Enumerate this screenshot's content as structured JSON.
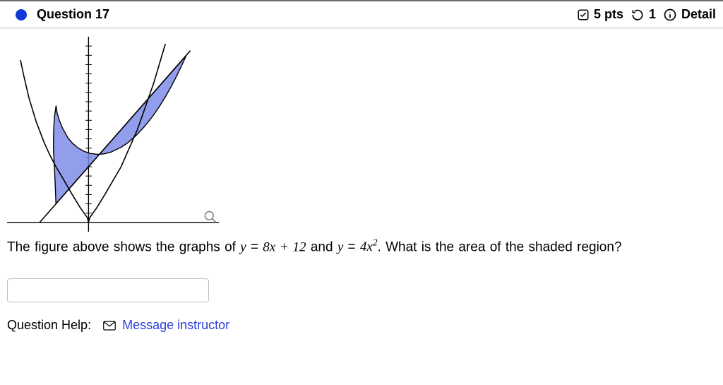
{
  "header": {
    "title": "Question 17",
    "points_text": "5 pts",
    "attempts_text": "1",
    "details_label": "Detail"
  },
  "graph": {
    "eq_line": "y = 8x + 12",
    "eq_parabola": "y = 4x^2",
    "x_range": [
      -2.5,
      4
    ],
    "y_range": [
      -2,
      40
    ],
    "intersections_x": [
      -1,
      3
    ],
    "shaded_fill": "#7a88e8",
    "shaded_stroke": "#000"
  },
  "prompt": {
    "lead": "The figure above shows the graphs of ",
    "mid1": " and ",
    "mid2": ". What is the area of the shaded region?",
    "eq1_lhs": "y",
    "eq1_rhs": "8x + 12",
    "eq2_lhs": "y",
    "eq2_rhs_base": "4x",
    "eq2_rhs_exp": "2",
    "eq_sign": " = "
  },
  "answer": {
    "value": "",
    "placeholder": ""
  },
  "help": {
    "label": "Question Help:",
    "link_text": "Message instructor"
  },
  "icons": {
    "bullet": "status-bullet-icon",
    "check": "check-square-icon",
    "retry": "retry-icon",
    "info": "info-circle-icon",
    "zoom": "zoom-icon",
    "mail": "mail-icon"
  },
  "chart_data": {
    "type": "line",
    "title": "",
    "xlabel": "",
    "ylabel": "",
    "x": [
      -2.5,
      -2,
      -1.5,
      -1,
      -0.5,
      0,
      0.5,
      1,
      1.5,
      2,
      2.5,
      3,
      3.5,
      4
    ],
    "series": [
      {
        "name": "y = 8x + 12",
        "values": [
          -8,
          -4,
          0,
          4,
          8,
          12,
          16,
          20,
          24,
          28,
          32,
          36,
          40,
          44
        ]
      },
      {
        "name": "y = 4x^2",
        "values": [
          25,
          16,
          9,
          4,
          1,
          0,
          1,
          4,
          9,
          16,
          25,
          36,
          49,
          64
        ]
      }
    ],
    "xlim": [
      -2.5,
      4
    ],
    "ylim": [
      -2,
      40
    ],
    "shaded_region_between": {
      "from_x": -1,
      "to_x": 3,
      "upper": "y = 8x + 12",
      "lower": "y = 4x^2"
    }
  }
}
